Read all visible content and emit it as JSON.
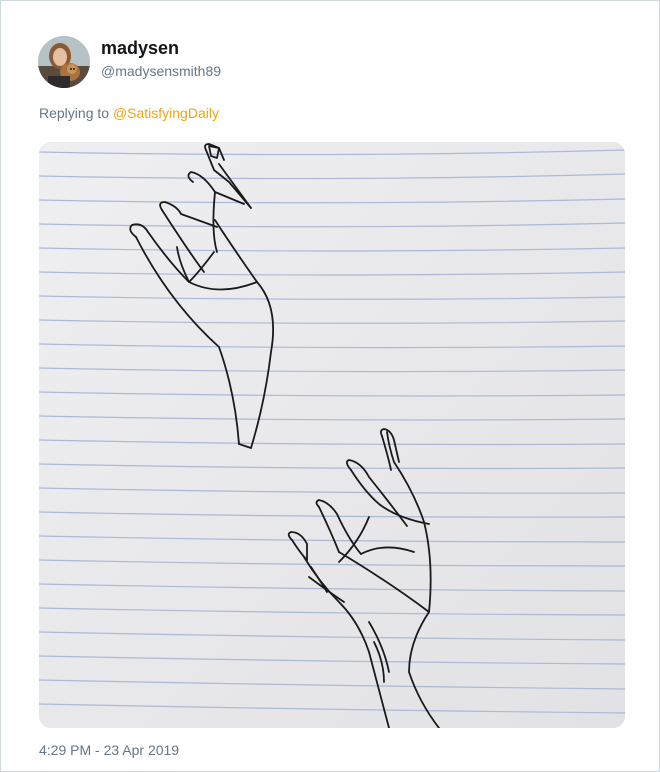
{
  "author": {
    "display_name": "madysen",
    "handle": "@madysensmith89"
  },
  "reply": {
    "prefix": "Replying to ",
    "mention": "@SatisfyingDaily"
  },
  "media": {
    "description": "Pen line drawing of two reaching hands on ruled notebook paper",
    "paper_color": "#ececee",
    "rule_color": "#a9b9d6",
    "ink_color": "#1a1a1a"
  },
  "timestamp": "4:29 PM - 23 Apr 2019",
  "colors": {
    "accent_mention": "#e8a718",
    "secondary_text": "#657786",
    "primary_text": "#14171a",
    "border": "#cfd9de"
  }
}
